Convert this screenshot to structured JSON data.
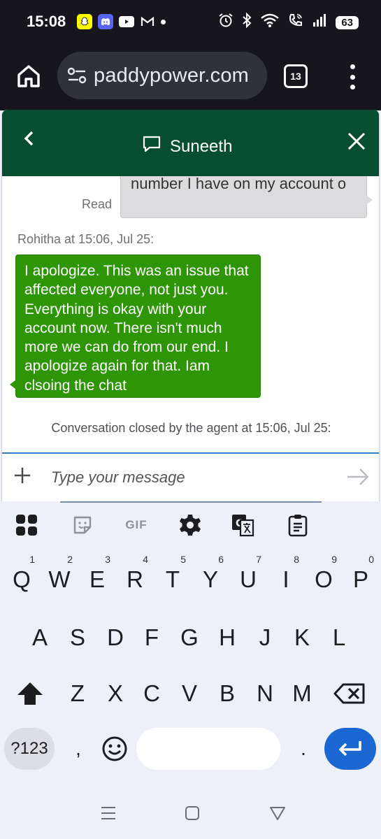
{
  "status_bar": {
    "time": "15:08",
    "battery": "63",
    "left_icons": [
      "snapchat-icon",
      "discord-icon",
      "youtube-icon",
      "gmail-icon",
      "dot-icon"
    ],
    "right_icons": [
      "alarm-icon",
      "bluetooth-icon",
      "wifi-icon",
      "wifi-calling-icon",
      "signal-icon"
    ]
  },
  "browser": {
    "url": "paddypower.com",
    "tab_count": "13"
  },
  "chat": {
    "title": "Suneeth",
    "messages": {
      "user_text": "number I have on my account o",
      "read_label": "Read",
      "agent_sender": "Rohitha at 15:06, Jul 25:",
      "agent_text": "I apologize. This was an issue that affected everyone, not just you. Everything is okay with your account now. There isn't much more we can do from our end. I apologize again for that. Iam clsoing the chat",
      "closed_note": "Conversation closed by the agent at 15:06, Jul 25:"
    },
    "composer": {
      "placeholder": "Type your message"
    },
    "colors": {
      "header_bg": "#064d31",
      "agent_bubble": "#2e9507",
      "user_bubble": "#dcdcde",
      "accent_line": "#2e7cc7"
    }
  },
  "keyboard": {
    "toolbar": [
      "apps-icon",
      "sticker-icon",
      "GIF",
      "settings-icon",
      "translate-icon",
      "clipboard-icon"
    ],
    "gif_label": "GIF",
    "row1": {
      "keys": [
        "Q",
        "W",
        "E",
        "R",
        "T",
        "Y",
        "U",
        "I",
        "O",
        "P"
      ],
      "hints": [
        "1",
        "2",
        "3",
        "4",
        "5",
        "6",
        "7",
        "8",
        "9",
        "0"
      ]
    },
    "row2": [
      "A",
      "S",
      "D",
      "F",
      "G",
      "H",
      "J",
      "K",
      "L"
    ],
    "row3": [
      "Z",
      "X",
      "C",
      "V",
      "B",
      "N",
      "M"
    ],
    "sym_label": "?123",
    "comma": ",",
    "period": ".",
    "enter_color": "#1a67d1"
  },
  "nav_bar": [
    "recents-icon",
    "home-icon",
    "back-icon"
  ]
}
